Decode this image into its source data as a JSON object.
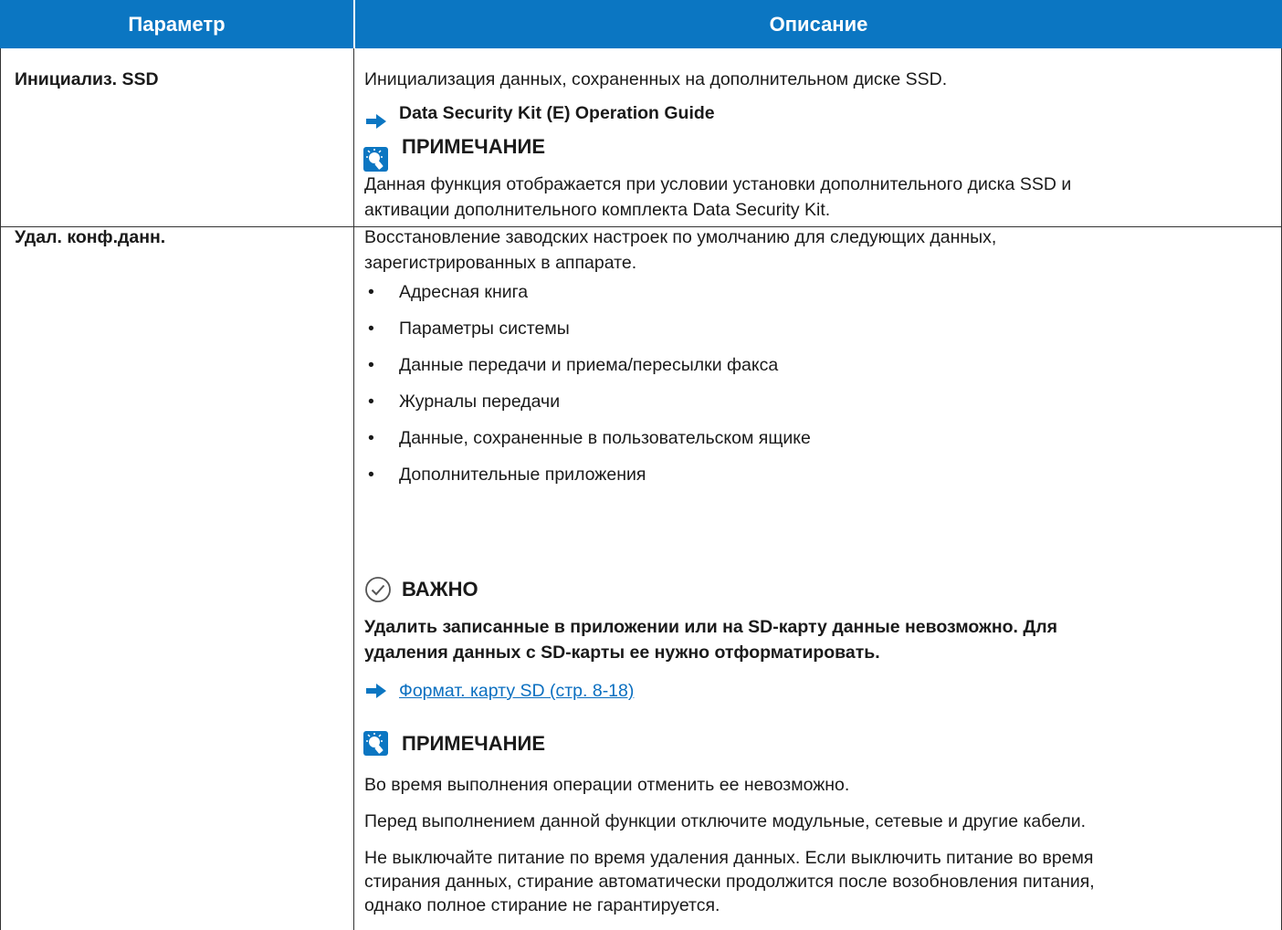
{
  "header": {
    "col1": "Параметр",
    "col2": "Описание"
  },
  "rows": [
    {
      "param": "Инициализ. SSD",
      "desc": "Инициализация данных, сохраненных на дополнительном диске SSD.",
      "ref": "Data Security Kit (E) Operation Guide",
      "note_title": "ПРИМЕЧАНИЕ",
      "note_lines": [
        "Данная функция отображается при условии установки дополнительного диска SSD и",
        "активации дополнительного комплекта Data Security Kit."
      ]
    },
    {
      "param": "Удал. конф.данн.",
      "desc_lines": [
        "Восстановление заводских настроек по умолчанию для следующих данных,",
        "зарегистрированных в аппарате."
      ],
      "bullets": [
        "Адресная книга",
        "Параметры системы",
        "Данные передачи и приема/пересылки факса",
        "Журналы передачи",
        "Данные, сохраненные в пользовательском ящике",
        "Дополнительные приложения"
      ],
      "important_title": "ВАЖНО",
      "important_lines": [
        "Удалить записанные в приложении или на SD-карту данные невозможно. Для",
        "удаления данных с SD-карты ее нужно отформатировать."
      ],
      "link": "Формат. карту SD (стр. 8-18)",
      "note_title": "ПРИМЕЧАНИЕ",
      "note_p1": "Во время выполнения операции отменить ее невозможно.",
      "note_p2": "Перед выполнением данной функции отключите модульные, сетевые и другие кабели.",
      "note_p3_lines": [
        "Не выключайте питание по время удаления данных. Если выключить питание во время",
        "стирания данных, стирание автоматически продолжится после возобновления питания,",
        "однако полное стирание не гарантируется."
      ]
    }
  ],
  "colors": {
    "header_bg": "#0b76c2",
    "link": "#0b6fc0",
    "arrow": "#0b76c2"
  }
}
